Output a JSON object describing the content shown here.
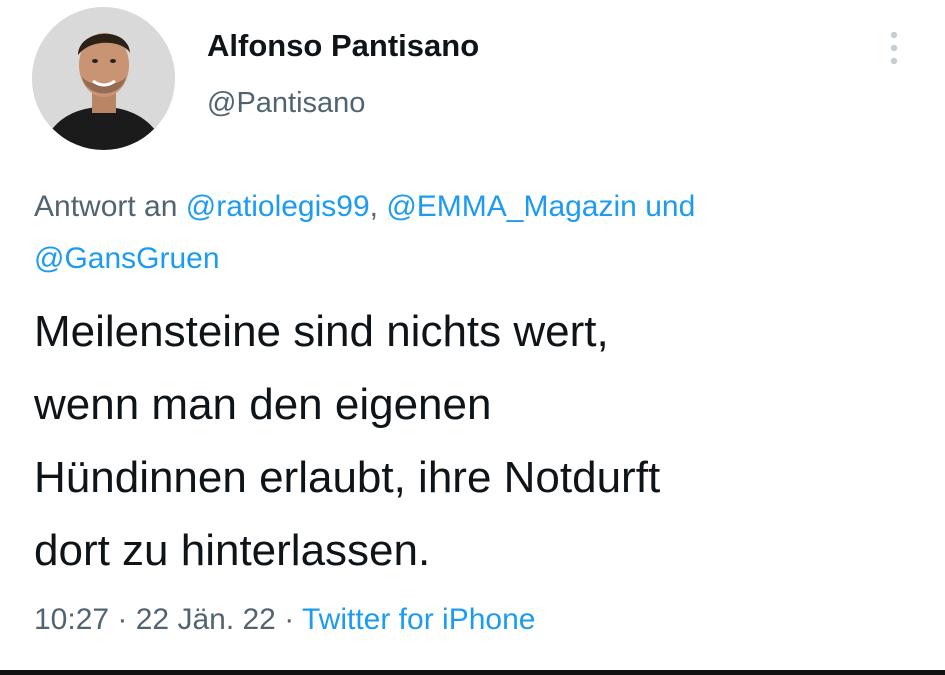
{
  "tweet": {
    "author": {
      "display_name": "Alfonso Pantisano",
      "handle": "@Pantisano"
    },
    "reply": {
      "prefix": "Antwort an ",
      "mentions": [
        "@ratiolegis99",
        "@EMMA_Magazin",
        "@GansGruen"
      ],
      "sep1": ", ",
      "sep2": " und"
    },
    "text_lines": [
      "Meilensteine sind nichts wert,",
      "wenn man den eigenen",
      "Hündinnen erlaubt, ihre Notdurft",
      "dort zu hinterlassen."
    ],
    "meta": {
      "time": "10:27",
      "date": "22 Jän. 22",
      "separator": " · ",
      "source": "Twitter for iPhone"
    }
  },
  "icons": {
    "more": "more-vertical-icon",
    "avatar": "profile-photo"
  },
  "colors": {
    "link": "#1d9bf0",
    "secondary_text": "#536471",
    "primary_text": "#0f1419"
  }
}
